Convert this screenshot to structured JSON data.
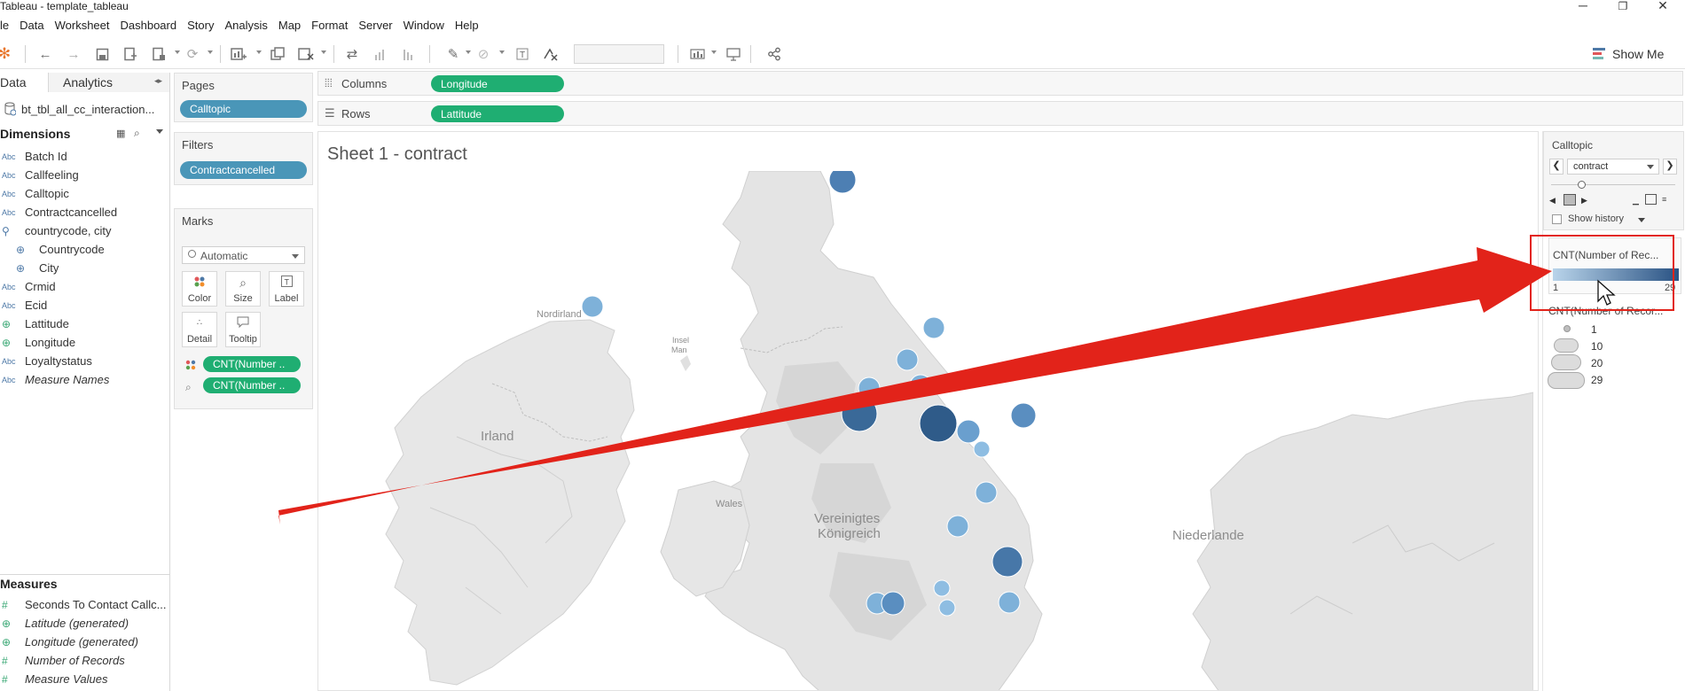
{
  "window": {
    "title": "Tableau - template_tableau",
    "controls": {
      "minimize": "─",
      "restore": "❐",
      "close": "✕"
    }
  },
  "menu": [
    "le",
    "Data",
    "Worksheet",
    "Dashboard",
    "Story",
    "Analysis",
    "Map",
    "Format",
    "Server",
    "Window",
    "Help"
  ],
  "toolbar": {
    "show_me_label": "Show Me"
  },
  "datapane": {
    "tab_data": "Data",
    "tab_analytics": "Analytics",
    "datasource": "bt_tbl_all_cc_interaction...",
    "dimensions_label": "Dimensions",
    "dimensions": [
      {
        "type": "Abc",
        "name": "Batch Id"
      },
      {
        "type": "Abc",
        "name": "Callfeeling"
      },
      {
        "type": "Abc",
        "name": "Calltopic"
      },
      {
        "type": "Abc",
        "name": "Contractcancelled"
      },
      {
        "type": "hier",
        "name": "countrycode, city"
      },
      {
        "type": "globe",
        "name": "Countrycode",
        "indent": true
      },
      {
        "type": "globe",
        "name": "City",
        "indent": true
      },
      {
        "type": "Abc",
        "name": "Crmid"
      },
      {
        "type": "Abc",
        "name": "Ecid"
      },
      {
        "type": "globe-green",
        "name": "Lattitude"
      },
      {
        "type": "globe-green",
        "name": "Longitude"
      },
      {
        "type": "Abc",
        "name": "Loyaltystatus"
      },
      {
        "type": "Abc",
        "name": "Measure Names",
        "italic": true
      }
    ],
    "measures_label": "Measures",
    "measures": [
      {
        "type": "#",
        "name": "Seconds To Contact Callc..."
      },
      {
        "type": "globe-green",
        "name": "Latitude (generated)",
        "italic": true
      },
      {
        "type": "globe-green",
        "name": "Longitude (generated)",
        "italic": true
      },
      {
        "type": "#",
        "name": "Number of Records",
        "italic": true
      },
      {
        "type": "#",
        "name": "Measure Values",
        "italic": true
      }
    ]
  },
  "cards": {
    "pages_label": "Pages",
    "pages_pill": "Calltopic",
    "filters_label": "Filters",
    "filters_pill": "Contractcancelled",
    "marks_label": "Marks",
    "mark_type": "Automatic",
    "mark_buttons": {
      "color": "Color",
      "size": "Size",
      "label": "Label",
      "detail": "Detail",
      "tooltip": "Tooltip"
    },
    "mark_pills": [
      "CNT(Number ..",
      "CNT(Number .."
    ]
  },
  "shelves": {
    "columns_label": "Columns",
    "columns_pill": "Longitude",
    "rows_label": "Rows",
    "rows_pill": "Lattitude"
  },
  "sheet": {
    "title": "Sheet 1 - contract"
  },
  "map": {
    "labels": [
      "Nordirland",
      "Insel",
      "Man",
      "Irland",
      "Wales",
      "Vereinigtes",
      "Königreich",
      "Niederlande"
    ]
  },
  "pages_card": {
    "title": "Calltopic",
    "selected": "contract",
    "show_history": "Show history"
  },
  "color_legend": {
    "title": "CNT(Number of Rec...",
    "min": "1",
    "max": "29",
    "low_color": "#b9d4ea",
    "high_color": "#2a5384"
  },
  "size_legend": {
    "title": "CNT(Number of Recor...",
    "values": [
      "1",
      "10",
      "20",
      "29"
    ]
  },
  "annotation": {
    "color": "#e2231a"
  }
}
